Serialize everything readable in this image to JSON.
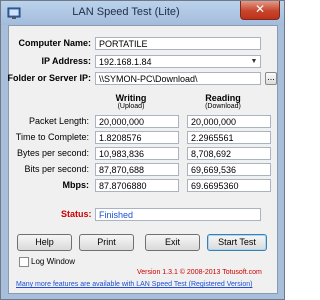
{
  "window": {
    "title": "LAN Speed Test (Lite)",
    "close_symbol": "✕"
  },
  "fields": {
    "computer_name_label": "Computer Name:",
    "computer_name_value": "PORTATILE",
    "ip_address_label": "IP Address:",
    "ip_address_value": "192.168.1.84",
    "folder_label": "Folder or Server IP:",
    "folder_value": "\\\\SYMON-PC\\Download\\",
    "browse_label": "..."
  },
  "results": {
    "writing_header": "Writing",
    "writing_sub": "(Upload)",
    "reading_header": "Reading",
    "reading_sub": "(Download)",
    "rows": [
      {
        "label": "Packet Length:",
        "writing": "20,000,000",
        "reading": "20,000,000"
      },
      {
        "label": "Time to Complete:",
        "writing": "1.8208576",
        "reading": "2.2965561"
      },
      {
        "label": "Bytes per second:",
        "writing": "10,983,836",
        "reading": "8,708,692"
      },
      {
        "label": "Bits per second:",
        "writing": "87,870,688",
        "reading": "69,669,536"
      },
      {
        "label": "Mbps:",
        "writing": "87.8706880",
        "reading": "69.6695360"
      }
    ]
  },
  "status": {
    "label": "Status:",
    "value": "Finished"
  },
  "buttons": {
    "help": "Help",
    "print": "Print",
    "exit": "Exit",
    "start_test": "Start Test"
  },
  "log_window": {
    "label": "Log Window",
    "checked": false
  },
  "footer": {
    "version": "Version 1.3.1 © 2008-2013 Totusoft.com",
    "promo": "Many more features are available with LAN Speed Test (Registered Version)"
  },
  "colors": {
    "status_label": "#cc0000",
    "status_value": "#1c4fd6",
    "version_text": "#cc0000",
    "link": "#1c4fd6",
    "window_frame": "#a8bfdc"
  }
}
